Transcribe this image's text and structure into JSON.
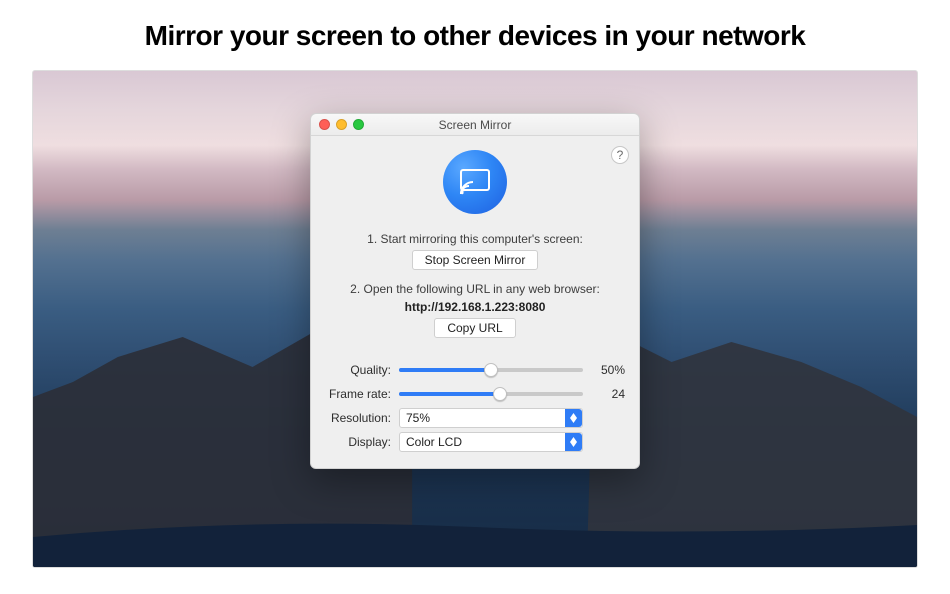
{
  "headline": "Mirror your screen to other devices in your network",
  "window": {
    "title": "Screen Mirror"
  },
  "help": {
    "label": "?"
  },
  "step1_text": "1. Start mirroring this computer's screen:",
  "stop_button_label": "Stop Screen Mirror",
  "step2_text": "2. Open the following URL in any web browser:",
  "url_text": "http://192.168.1.223:8080",
  "copy_button_label": "Copy URL",
  "quality": {
    "label": "Quality:",
    "value_text": "50%",
    "percent": 50
  },
  "framerate": {
    "label": "Frame rate:",
    "value_text": "24",
    "percent": 55
  },
  "resolution": {
    "label": "Resolution:",
    "selected": "75%"
  },
  "display": {
    "label": "Display:",
    "selected": "Color LCD"
  }
}
